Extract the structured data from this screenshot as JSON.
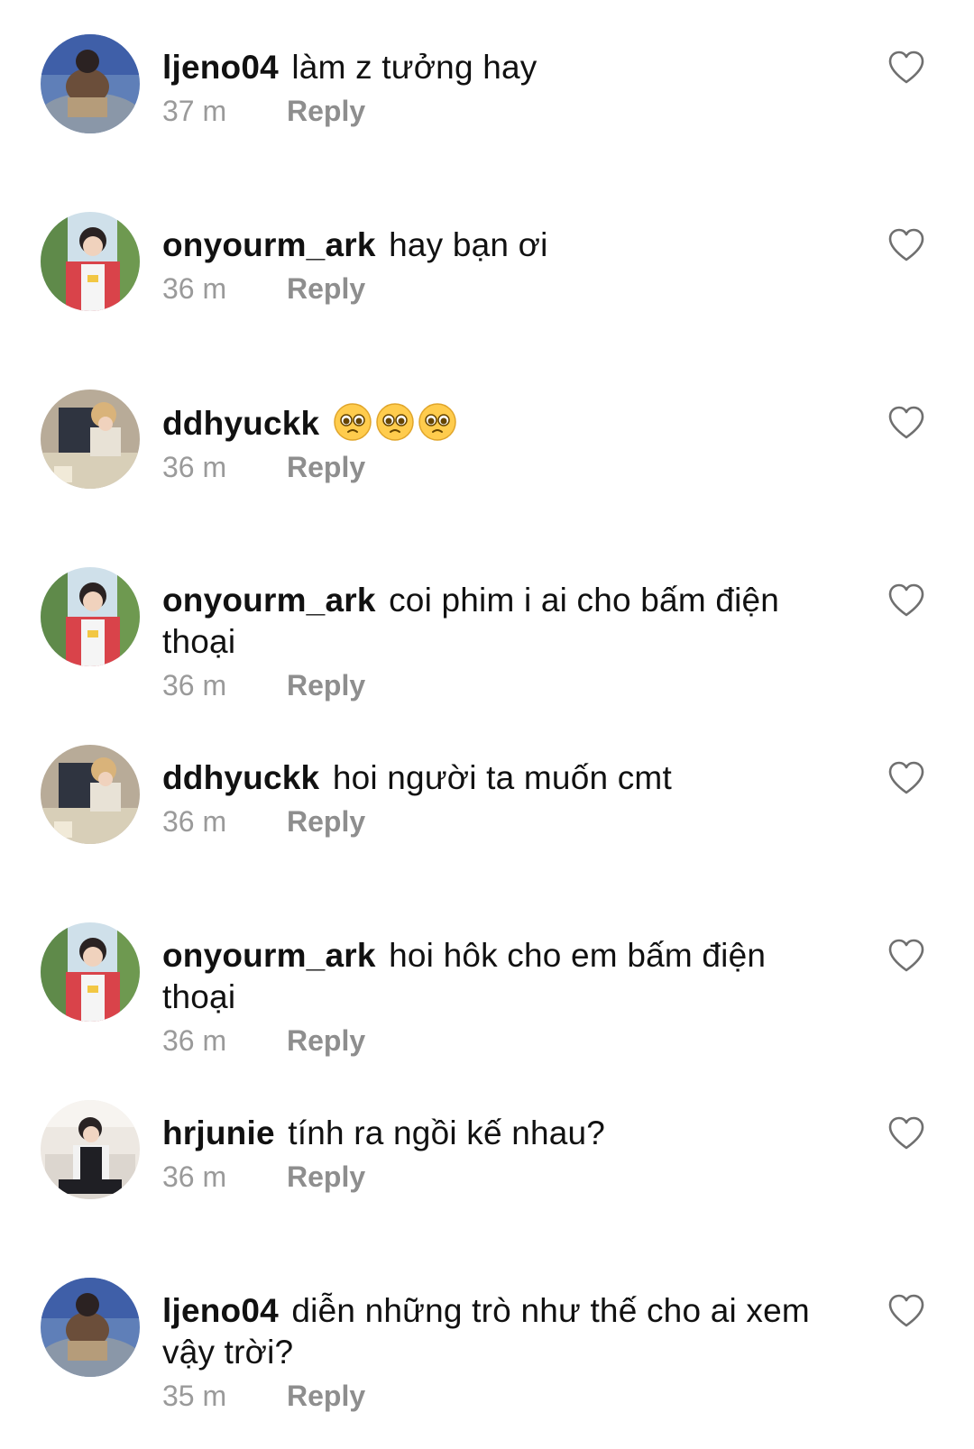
{
  "comments": [
    {
      "username": "ljeno04",
      "text": "làm z tưởng hay",
      "time": "37 m",
      "reply": "Reply",
      "avatar": "avatar-photo-blue"
    },
    {
      "username": "onyourm_ark",
      "text": "hay bạn ơi",
      "time": "36 m",
      "reply": "Reply",
      "avatar": "avatar-photo-plaid"
    },
    {
      "username": "ddhyuckk",
      "text": "🥺🥺🥺",
      "time": "36 m",
      "reply": "Reply",
      "avatar": "avatar-photo-dining"
    },
    {
      "username": "onyourm_ark",
      "text": "coi phim i ai cho bấm điện thoại",
      "time": "36 m",
      "reply": "Reply",
      "avatar": "avatar-photo-plaid"
    },
    {
      "username": "ddhyuckk",
      "text": "hoi người ta muốn cmt",
      "time": "36 m",
      "reply": "Reply",
      "avatar": "avatar-photo-dining"
    },
    {
      "username": "onyourm_ark",
      "text": "hoi hôk cho em bấm điện thoại",
      "time": "36 m",
      "reply": "Reply",
      "avatar": "avatar-photo-plaid"
    },
    {
      "username": "hrjunie",
      "text": "tính ra ngồi kế nhau?",
      "time": "36 m",
      "reply": "Reply",
      "avatar": "avatar-photo-sofa"
    },
    {
      "username": "ljeno04",
      "text": "diễn những trò như thế cho ai xem vậy trời?",
      "time": "35 m",
      "reply": "Reply",
      "avatar": "avatar-photo-blue"
    }
  ],
  "icons": {
    "like": "heart-outline-icon",
    "emoji": "pleading-face-emoji"
  },
  "colors": {
    "text": "#111111",
    "meta": "#9a9a9a",
    "reply": "#8e8e8e",
    "background": "#ffffff"
  }
}
